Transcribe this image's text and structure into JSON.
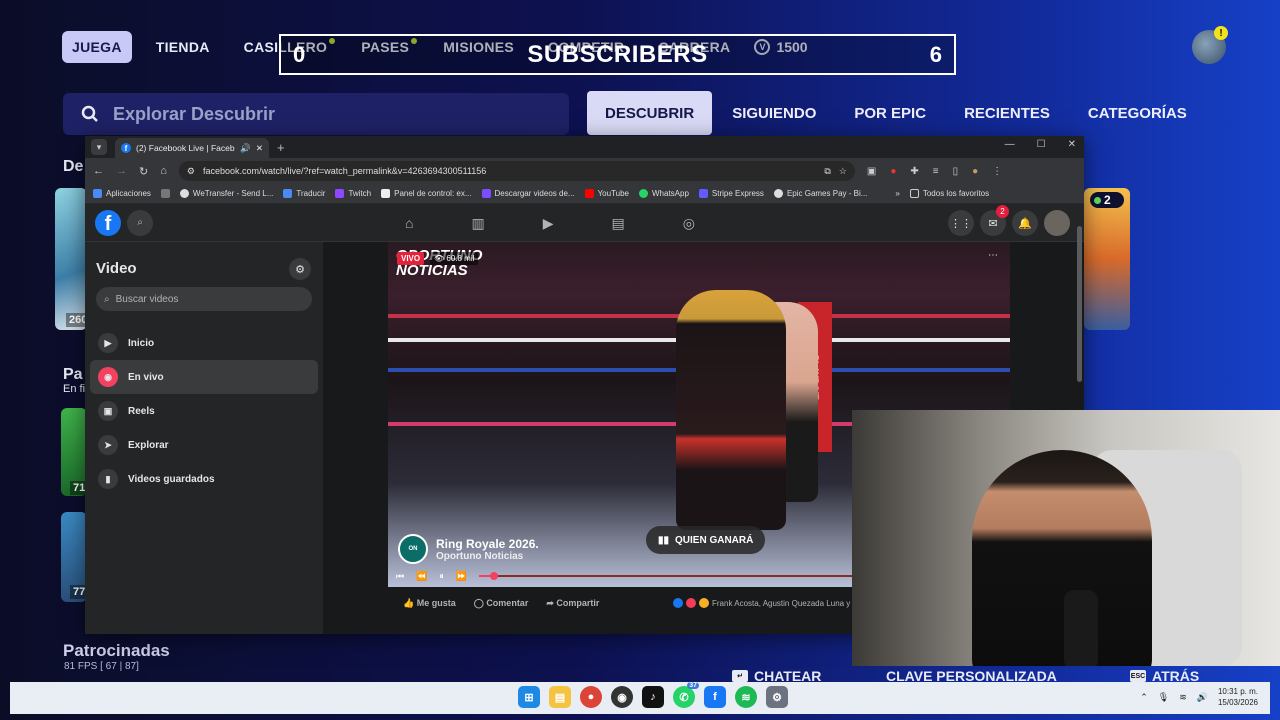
{
  "epic": {
    "nav": [
      {
        "label": "JUEGA",
        "active": true,
        "dot": false
      },
      {
        "label": "TIENDA",
        "active": false,
        "dot": false
      },
      {
        "label": "CASILLERO",
        "active": false,
        "dot": true
      },
      {
        "label": "PASES",
        "active": false,
        "dot": true
      },
      {
        "label": "MISIONES",
        "active": false,
        "dot": false
      },
      {
        "label": "COMPETIR",
        "active": false,
        "dot": false
      },
      {
        "label": "CARRERA",
        "active": false,
        "dot": false
      }
    ],
    "vbucks": "1500",
    "alert_badge": "!",
    "search_placeholder": "Explorar Descubrir",
    "tabs": [
      {
        "label": "DESCUBRIR",
        "active": true
      },
      {
        "label": "SIGUIENDO",
        "active": false
      },
      {
        "label": "POR EPIC",
        "active": false
      },
      {
        "label": "RECIENTES",
        "active": false
      },
      {
        "label": "CATEGORÍAS",
        "active": false
      }
    ],
    "side_texts": {
      "de": "De",
      "pa": "Pa",
      "en_fi": "En fi"
    },
    "card_nums": {
      "c1": "260",
      "c2": "71",
      "c3": "77"
    },
    "right_badge": "2",
    "patrocinadas": "Patrocinadas",
    "fps_line": "81 FPS [ 67 | 87]",
    "bottom_buttons": {
      "chat": "CHATEAR",
      "clave": "CLAVE PERSONALIZADA",
      "atras": "ATRÁS"
    },
    "colors": {
      "accent": "#c8c9f6",
      "background": "#0d1150",
      "dot": "#b8e23a"
    }
  },
  "overlay": {
    "subs_left": "0",
    "subs_label": "SUBSCRIBERS",
    "subs_right": "6"
  },
  "browser": {
    "tab_title": "(2) Facebook Live | Facebook",
    "url": "facebook.com/watch/live/?ref=watch_permalink&v=4263694300511156",
    "bookmarks": [
      "Aplicaciones",
      "WeTransfer - Send L...",
      "Traducir",
      "Twitch",
      "Panel de control: ex...",
      "Descargar videos de...",
      "YouTube",
      "WhatsApp",
      "Stripe Express",
      "Epic Games Pay - Bi..."
    ],
    "all_bookmarks": "Todos los favoritos"
  },
  "facebook": {
    "messenger_badge": "2",
    "sidebar_title": "Video",
    "search_placeholder": "Buscar videos",
    "menu": [
      {
        "label": "Inicio",
        "icon": "play-icon",
        "active": false
      },
      {
        "label": "En vivo",
        "icon": "live-icon",
        "active": true
      },
      {
        "label": "Reels",
        "icon": "reels-icon",
        "active": false
      },
      {
        "label": "Explorar",
        "icon": "explore-icon",
        "active": false
      },
      {
        "label": "Videos guardados",
        "icon": "bookmark-icon",
        "active": false
      }
    ],
    "video": {
      "logo": "OPORTUNO NOTICIAS",
      "live_label": "VIVO",
      "viewers": "60.8 mil",
      "title": "Ring Royale 2026.",
      "channel": "Oportuno Noticias",
      "poll": "QUIEN GANARÁ",
      "progress": 0.03,
      "corner_text": "PLAYDOIT"
    },
    "actions": {
      "like": "Me gusta",
      "comment": "Comentar",
      "share": "Compartir"
    },
    "reactions_text": "Frank Acosta, Agustin Quezada Luna y 7..."
  },
  "taskbar": {
    "apps": [
      "windows-start",
      "file-explorer",
      "chrome",
      "obs",
      "tiktok",
      "whatsapp",
      "facebook",
      "spotify",
      "settings"
    ],
    "whatsapp_badge": "37",
    "time": "10:31 p. m.",
    "date": "15/03/2026"
  }
}
